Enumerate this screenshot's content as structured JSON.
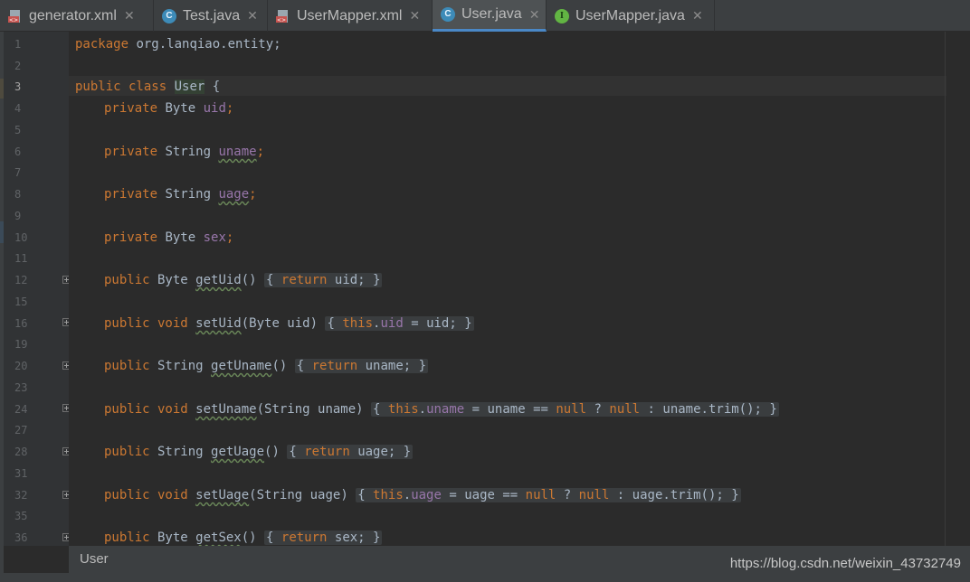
{
  "tabs": [
    {
      "label": "generator.xml",
      "icon": "xml-file-icon",
      "active": false
    },
    {
      "label": "Test.java",
      "icon": "java-class-icon",
      "active": false
    },
    {
      "label": "UserMapper.xml",
      "icon": "xml-file-icon",
      "active": false
    },
    {
      "label": "User.java",
      "icon": "java-class-icon",
      "active": true
    },
    {
      "label": "UserMapper.java",
      "icon": "java-interface-icon",
      "active": false
    }
  ],
  "close_glyph": "✕",
  "gutter_numbers": [
    "1",
    "2",
    "3",
    "4",
    "5",
    "6",
    "7",
    "8",
    "9",
    "10",
    "11",
    "12",
    "15",
    "16",
    "19",
    "20",
    "23",
    "24",
    "27",
    "28",
    "31",
    "32",
    "35",
    "36"
  ],
  "code": {
    "l1": {
      "kw": "package",
      "rest": " org.lanqiao.entity;"
    },
    "l3": {
      "kw": "public class",
      "cls": "User",
      "rest": " {"
    },
    "l4": {
      "kw": "private",
      "type": " Byte ",
      "field": "uid",
      "end": ";"
    },
    "l6": {
      "kw": "private",
      "type": " String ",
      "field": "uname",
      "end": ";"
    },
    "l8": {
      "kw": "private",
      "type": " String ",
      "field": "uage",
      "end": ";"
    },
    "l10": {
      "kw": "private",
      "type": " Byte ",
      "field": "sex",
      "end": ";"
    },
    "l12": {
      "kw": "public",
      "type": " Byte ",
      "fn": "getUid",
      "params": "()",
      "body": "{ return uid; }"
    },
    "l16": {
      "kw": "public void",
      "fn": "setUid",
      "params": "(Byte uid)",
      "body": "{ this.uid = uid; }"
    },
    "l20": {
      "kw": "public",
      "type": " String ",
      "fn": "getUname",
      "params": "()",
      "body": "{ return uname; }"
    },
    "l24": {
      "kw": "public void",
      "fn": "setUname",
      "params": "(String uname)",
      "body": "{ this.uname = uname == null ? null : uname.trim(); }"
    },
    "l28": {
      "kw": "public",
      "type": " String ",
      "fn": "getUage",
      "params": "()",
      "body": "{ return uage; }"
    },
    "l32": {
      "kw": "public void",
      "fn": "setUage",
      "params": "(String uage)",
      "body": "{ this.uage = uage == null ? null : uage.trim(); }"
    },
    "l36": {
      "kw": "public",
      "type": " Byte ",
      "fn": "getSex",
      "params": "()",
      "body": "{ return sex; }"
    }
  },
  "breadcrumb": "User",
  "watermark": "https://blog.csdn.net/weixin_43732749",
  "colors": {
    "keyword": "#cc7832",
    "field": "#9876aa",
    "text": "#a9b7c6",
    "accent": "#4a88c7"
  }
}
